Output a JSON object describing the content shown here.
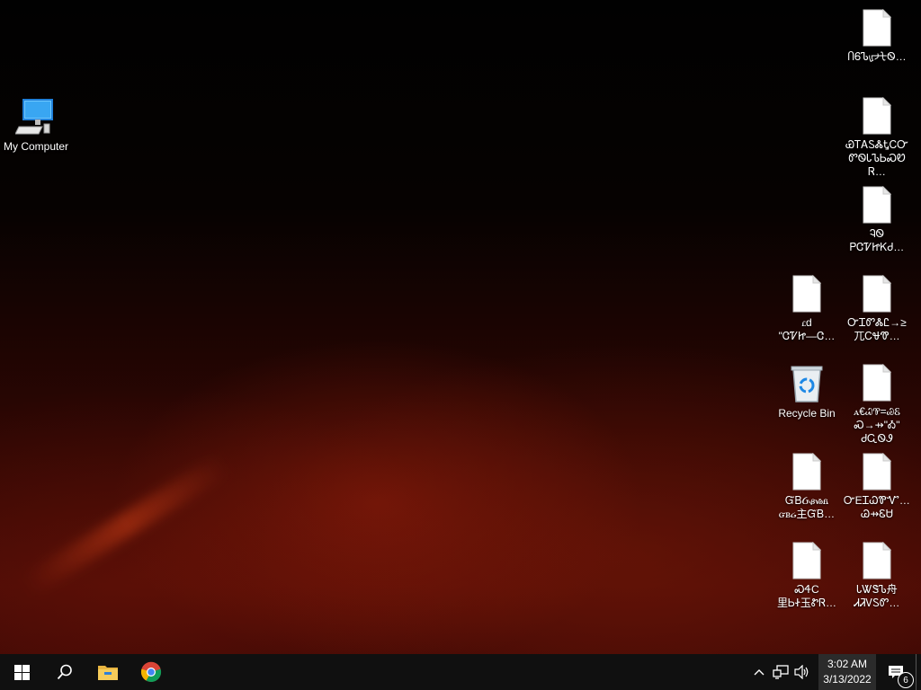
{
  "desktop": {
    "my_computer": {
      "label": "My Computer",
      "icon": "computer-icon"
    },
    "recycle_bin": {
      "label": "Recycle Bin",
      "icon": "recycle-bin-icon"
    },
    "files": [
      {
        "label": "ႶᏮᏖᡁᢣᡫᏫ…",
        "icon": "file-icon"
      },
      {
        "label": "ᏯᎢᎪᏚᏜᎿᏟᏅ\nᏛᏫᏓᏖᏏᏍᏬᏒ…",
        "icon": "file-icon"
      },
      {
        "label": "ᎸᏫ\nᏢᏣᏤᏥᏦᏧ…",
        "icon": "file-icon"
      },
      {
        "label": "ꮭd\n\"ᏣᏤᏥ—Ꮳ…",
        "icon": "file-icon"
      },
      {
        "label": "ᏅᏆᏛᏜᏝ→≥\n兀ᏟᏠᏡ…",
        "icon": "file-icon"
      },
      {
        "label": "ꭺ€ᏇᏈ=ᏊᏋ\nᏍ→⇸\"Ꭳ\"\nᏧᏩᏫᏭ",
        "icon": "file-icon"
      },
      {
        "label": "ᏳᏴᏵᏸᏹᏺ\nᏻᏼᏽ主ᏳᏴ…",
        "icon": "file-icon"
      },
      {
        "label": "ᏅEᏆᏇᏈᏉ…\nᏊ⇸ᏋᏌ",
        "icon": "file-icon"
      },
      {
        "label": "ᏍᏎC\n里ᏏᏐ玉ᏑᏒ…",
        "icon": "file-icon"
      },
      {
        "label": "ᏓᏔᏕᏖ舟\nᏗᏘᏙᏚᏛ…",
        "icon": "file-icon"
      }
    ]
  },
  "taskbar": {
    "start": "windows-start-icon",
    "search": "search-icon",
    "file_explorer": "file-explorer-icon",
    "chrome": "chrome-icon",
    "tray": {
      "time": "3:02 AM",
      "date": "3/13/2022",
      "notification_count": "6"
    }
  }
}
